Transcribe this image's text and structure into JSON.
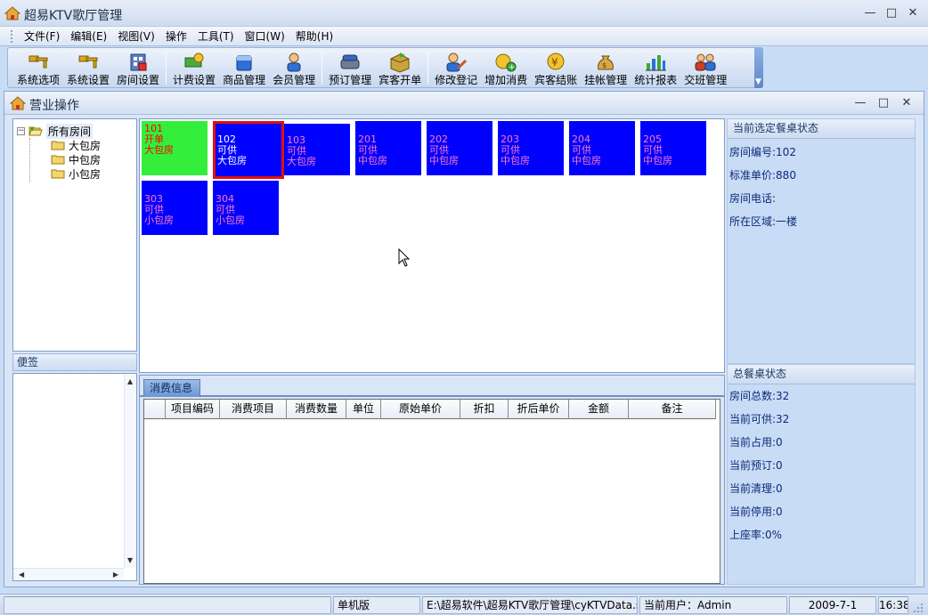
{
  "window": {
    "title": "超易KTV歌厅管理",
    "minimize": "—",
    "maximize": "□",
    "close": "✕"
  },
  "menu": [
    {
      "label": "文件(F)"
    },
    {
      "label": "编辑(E)"
    },
    {
      "label": "视图(V)"
    },
    {
      "label": "操作"
    },
    {
      "label": "工具(T)"
    },
    {
      "label": "窗口(W)"
    },
    {
      "label": "帮助(H)"
    }
  ],
  "toolbar": {
    "buttons": [
      {
        "label": "系统选项",
        "icon": "key-icon"
      },
      {
        "label": "系统设置",
        "icon": "key-icon"
      },
      {
        "label": "房间设置",
        "icon": "building-icon"
      },
      {
        "label": "计费设置",
        "icon": "money-icon"
      },
      {
        "label": "商品管理",
        "icon": "goods-icon"
      },
      {
        "label": "会员管理",
        "icon": "member-icon"
      },
      {
        "label": "预订管理",
        "icon": "phone-icon"
      },
      {
        "label": "宾客开单",
        "icon": "box-icon"
      },
      {
        "label": "修改登记",
        "icon": "edit-user-icon"
      },
      {
        "label": "增加消费",
        "icon": "add-consume-icon"
      },
      {
        "label": "宾客结账",
        "icon": "yen-coin-icon"
      },
      {
        "label": "挂帐管理",
        "icon": "money-bag-icon"
      },
      {
        "label": "统计报表",
        "icon": "bar-chart-icon"
      },
      {
        "label": "交班管理",
        "icon": "shift-users-icon"
      }
    ]
  },
  "child": {
    "title": "营业操作",
    "minimize": "—",
    "maximize": "□",
    "close": "✕"
  },
  "tree": {
    "root": "所有房间",
    "expander": "−",
    "children": [
      "大包房",
      "中包房",
      "小包房"
    ]
  },
  "note": {
    "header": "便签"
  },
  "rooms": [
    {
      "number": "101",
      "status": "开单",
      "type": "大包房",
      "state": "open"
    },
    {
      "number": "102",
      "status": "可供",
      "type": "大包房",
      "state": "selected"
    },
    {
      "number": "103",
      "status": "可供",
      "type": "大包房",
      "state": "available"
    },
    {
      "number": "201",
      "status": "可供",
      "type": "中包房",
      "state": "available"
    },
    {
      "number": "202",
      "status": "可供",
      "type": "中包房",
      "state": "available"
    },
    {
      "number": "203",
      "status": "可供",
      "type": "中包房",
      "state": "available"
    },
    {
      "number": "204",
      "status": "可供",
      "type": "中包房",
      "state": "available"
    },
    {
      "number": "205",
      "status": "可供",
      "type": "中包房",
      "state": "available"
    },
    {
      "number": "303",
      "status": "可供",
      "type": "小包房",
      "state": "available"
    },
    {
      "number": "304",
      "status": "可供",
      "type": "小包房",
      "state": "available"
    }
  ],
  "consume": {
    "tab": "消费信息",
    "columns": [
      "",
      "项目编码",
      "消费项目",
      "消费数量",
      "单位",
      "原始单价",
      "折扣",
      "折后单价",
      "金额",
      "备注"
    ]
  },
  "selected_info": {
    "header": "当前选定餐桌状态",
    "rows": [
      "房间编号:102",
      "标准单价:880",
      "房间电话:",
      "所在区域:一楼"
    ]
  },
  "total_info": {
    "header": "总餐桌状态",
    "rows": [
      "房间总数:32",
      "当前可供:32",
      "当前占用:0",
      "当前预订:0",
      "当前清理:0",
      "当前停用:0",
      "上座率:0%"
    ]
  },
  "status": {
    "edition": "单机版",
    "db_path": "E:\\超易软件\\超易KTV歌厅管理\\cyKTVData.sys",
    "user": "当前用户：Admin",
    "date": "2009-7-1",
    "time": "16:38"
  },
  "colors": {
    "room_available": "#0000ff",
    "room_open": "#33ef3b",
    "room_selected_border": "#e01010"
  }
}
